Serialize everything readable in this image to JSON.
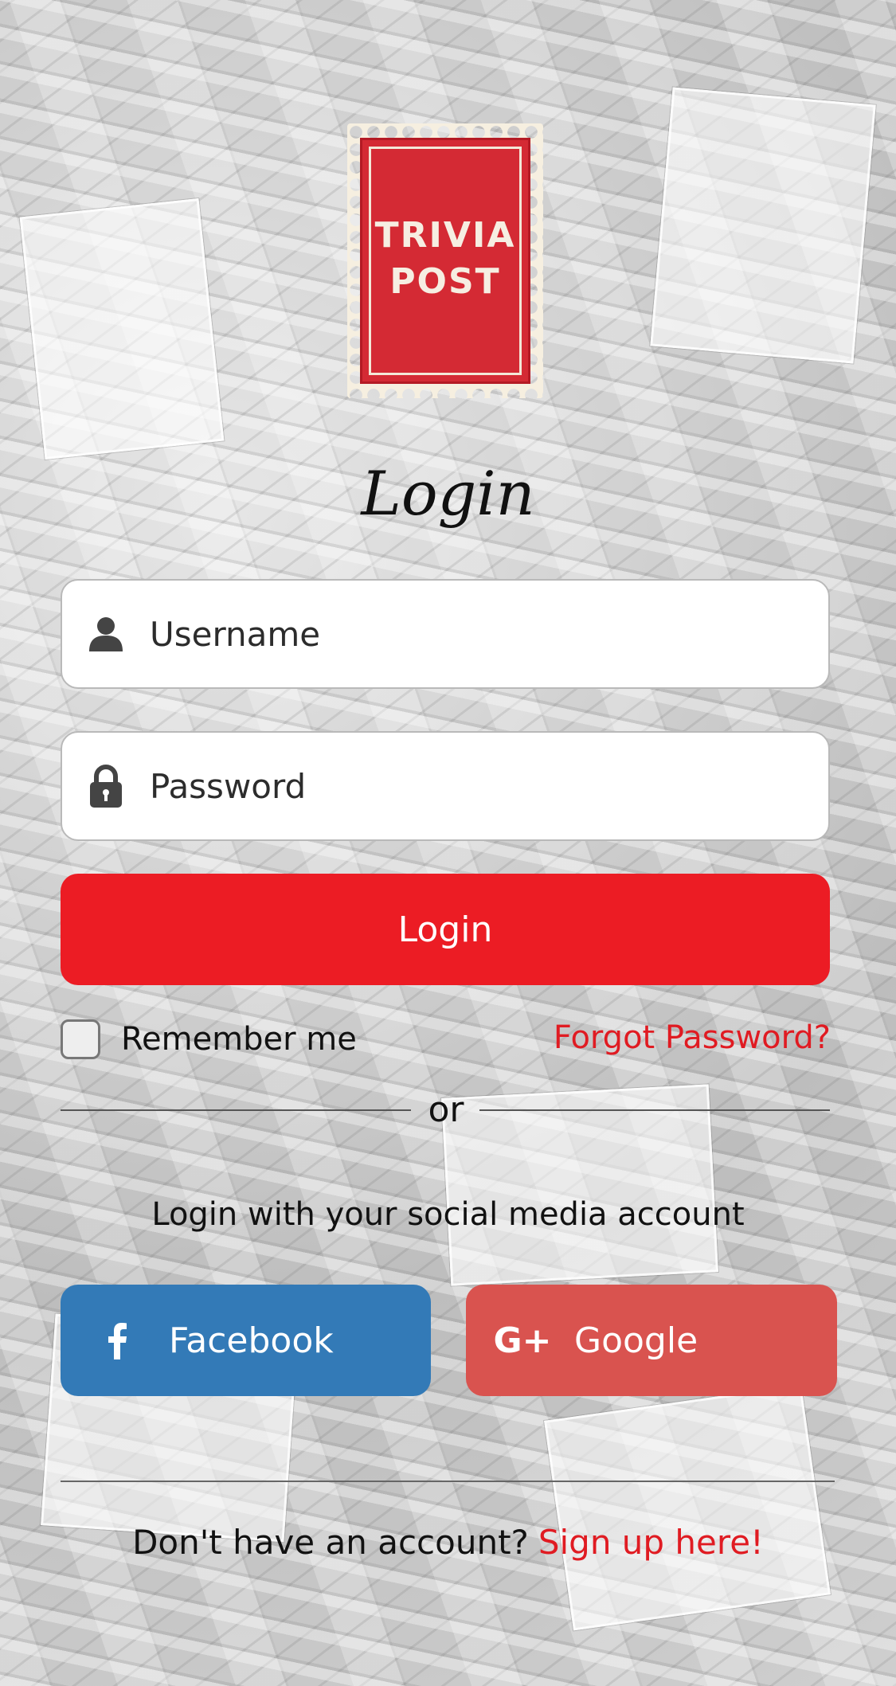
{
  "logo": {
    "text_line1": "TRIVIA",
    "text_line2": "POST"
  },
  "title": "Login",
  "form": {
    "username_placeholder": "Username",
    "password_placeholder": "Password",
    "login_button": "Login",
    "remember_label": "Remember me",
    "forgot_link": "Forgot Password?"
  },
  "divider_text": "or",
  "social": {
    "heading": "Login with your social media account",
    "facebook_label": "Facebook",
    "google_label": "Google",
    "google_icon_text": "G+"
  },
  "footer": {
    "prompt": "Don't have an account?",
    "signup_link": "Sign up here!"
  },
  "colors": {
    "login_button": "#ec1c24",
    "facebook": "#337ab7",
    "google": "#d9534f",
    "link": "#e01b22"
  },
  "icons": [
    "user-icon",
    "lock-icon",
    "facebook-icon",
    "google-plus-icon"
  ]
}
